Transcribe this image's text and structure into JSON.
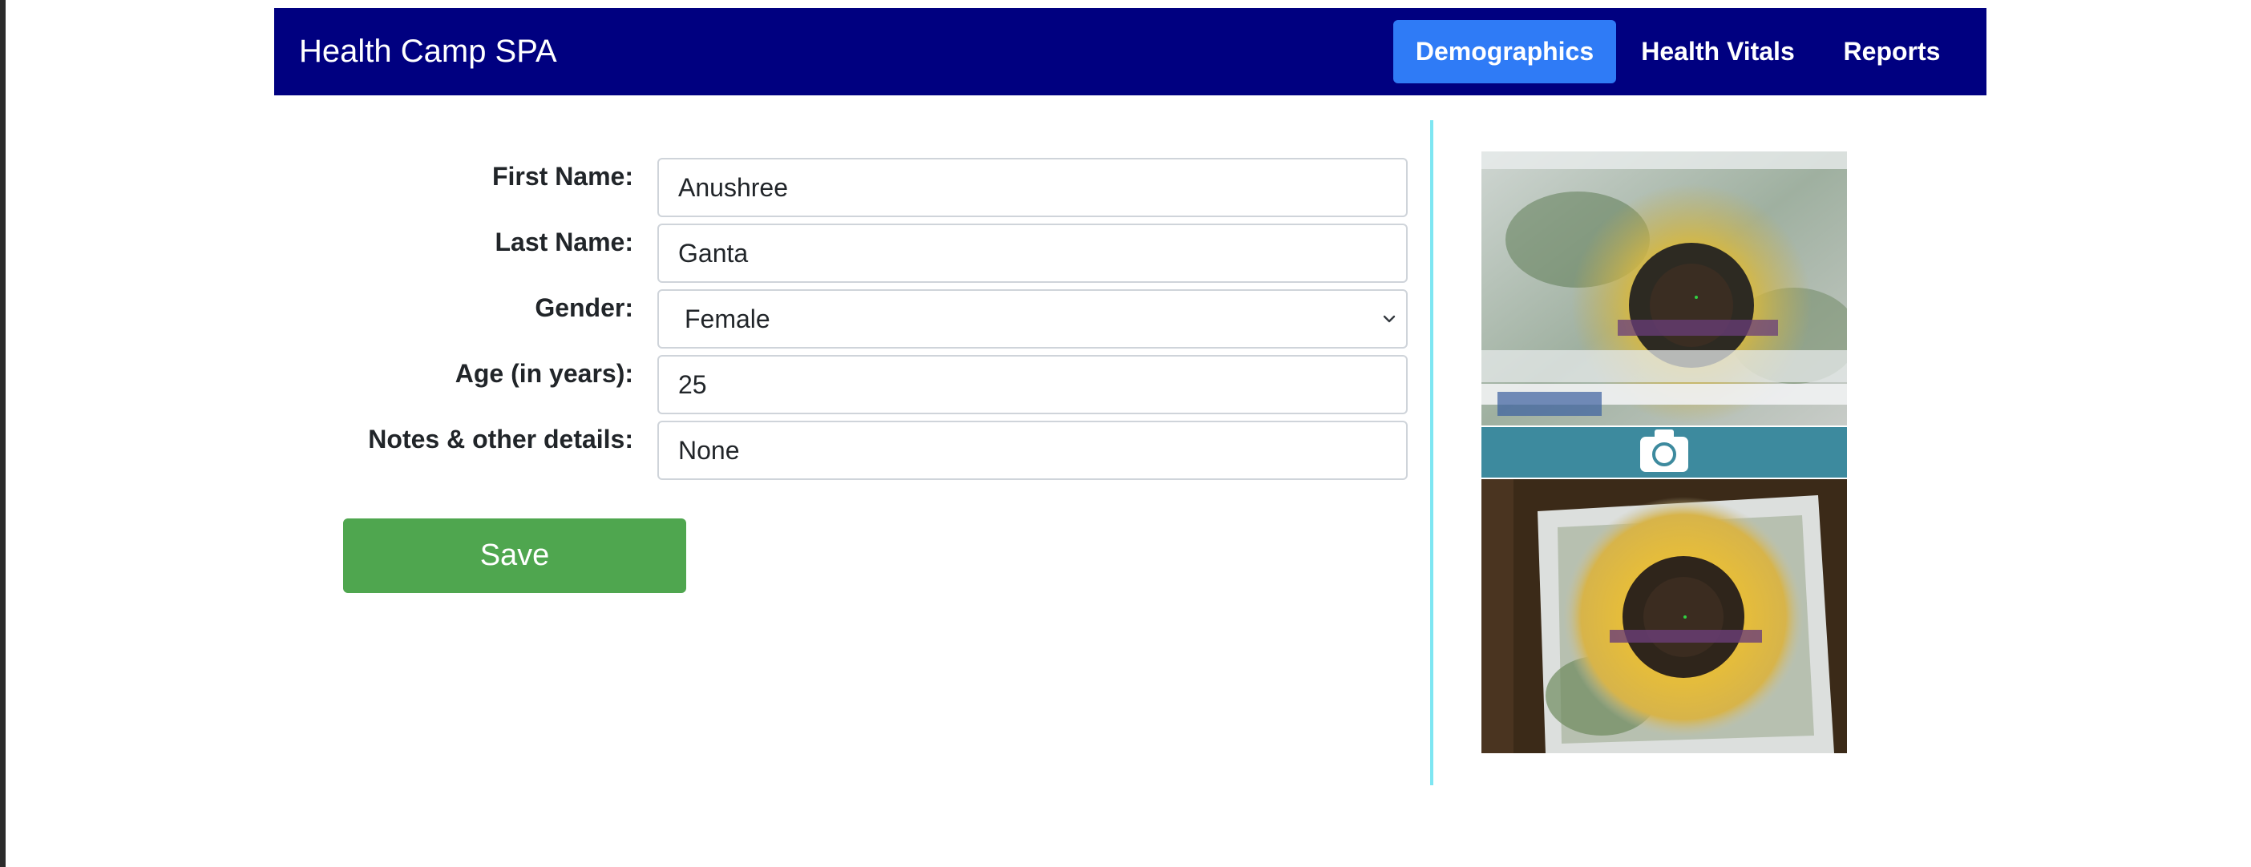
{
  "app": {
    "title": "Health Camp SPA"
  },
  "nav": {
    "items": [
      {
        "label": "Demographics",
        "active": true
      },
      {
        "label": "Health Vitals",
        "active": false
      },
      {
        "label": "Reports",
        "active": false
      }
    ]
  },
  "form": {
    "first_name": {
      "label": "First Name:",
      "value": "Anushree"
    },
    "last_name": {
      "label": "Last Name:",
      "value": "Ganta"
    },
    "gender": {
      "label": "Gender:",
      "value": "Female"
    },
    "age": {
      "label": "Age (in years):",
      "value": "25"
    },
    "notes": {
      "label": "Notes & other details:",
      "value": "None"
    },
    "save_label": "Save"
  },
  "capture": {
    "icon": "camera-icon"
  },
  "colors": {
    "navbar": "#000080",
    "active_tab": "#2f7bf6",
    "save_button": "#4fa64f",
    "capture_bar": "#3d8a9e",
    "divider": "#7ee6f2"
  }
}
